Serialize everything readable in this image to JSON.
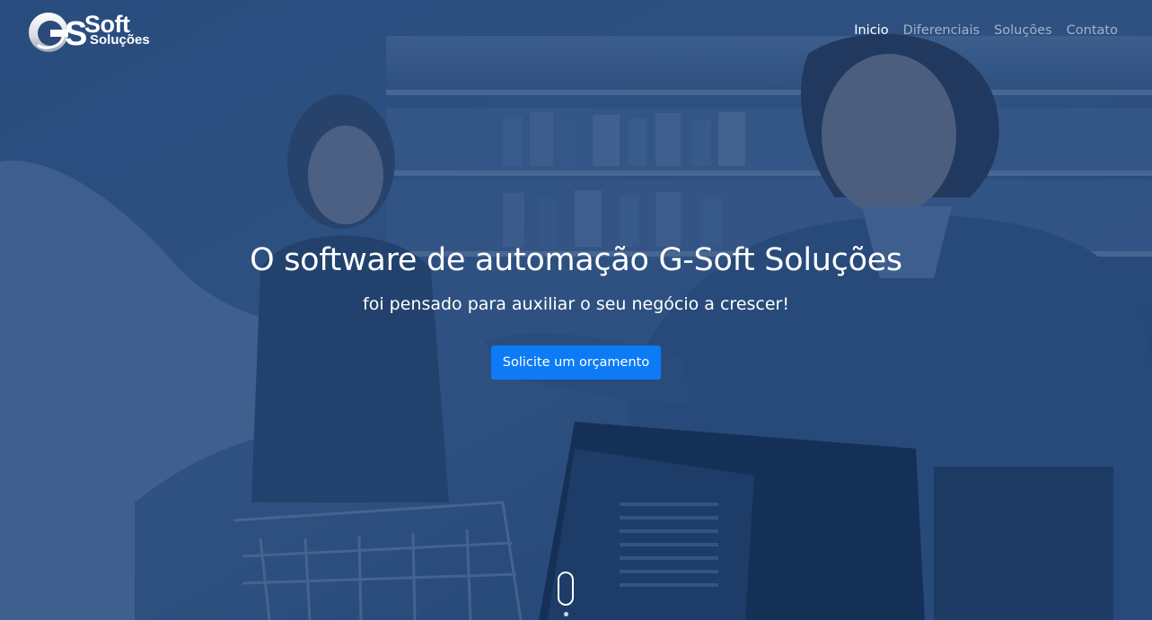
{
  "brand": {
    "logo_letter": "G",
    "logo_main": "Soft",
    "logo_sub": "Soluções"
  },
  "nav": {
    "items": [
      {
        "label": "Inicio",
        "active": true
      },
      {
        "label": "Diferenciais",
        "active": false
      },
      {
        "label": "Soluções",
        "active": false
      },
      {
        "label": "Contato",
        "active": false
      }
    ]
  },
  "hero": {
    "title": "O software de automação G-Soft Soluções",
    "subtitle": "foi pensado para auxiliar o seu negócio a crescer!",
    "cta_label": "Solicite um orçamento"
  },
  "icons": {
    "scroll": "mouse-scroll-icon"
  },
  "colors": {
    "overlay": "#183a6c",
    "cta": "#0d7bf5",
    "nav_active": "#ffffff",
    "nav_inactive": "#9fb1cb"
  }
}
